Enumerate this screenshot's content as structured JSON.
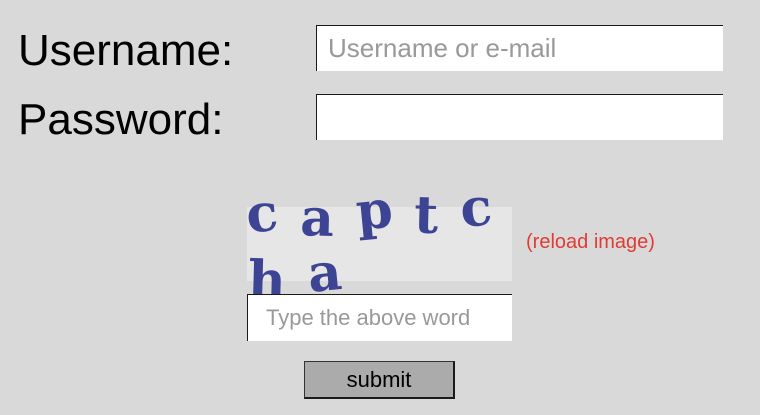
{
  "login_form": {
    "username_label": "Username:",
    "password_label": "Password:",
    "username_field": {
      "value": "",
      "placeholder": "Username or e-mail"
    },
    "password_field": {
      "value": "",
      "placeholder": ""
    }
  },
  "captcha": {
    "image_word": [
      "c",
      "a",
      "p",
      "t",
      "c",
      "h",
      "a"
    ],
    "image_text_color": "#3d4494",
    "image_background": "#e6e6e6",
    "reload_label": "(reload image)",
    "reload_color": "#e23b34",
    "input": {
      "value": "",
      "placeholder": "Type the above word"
    }
  },
  "submit": {
    "label": "submit",
    "background": "#ababab"
  },
  "page_background": "#d9d9d9"
}
